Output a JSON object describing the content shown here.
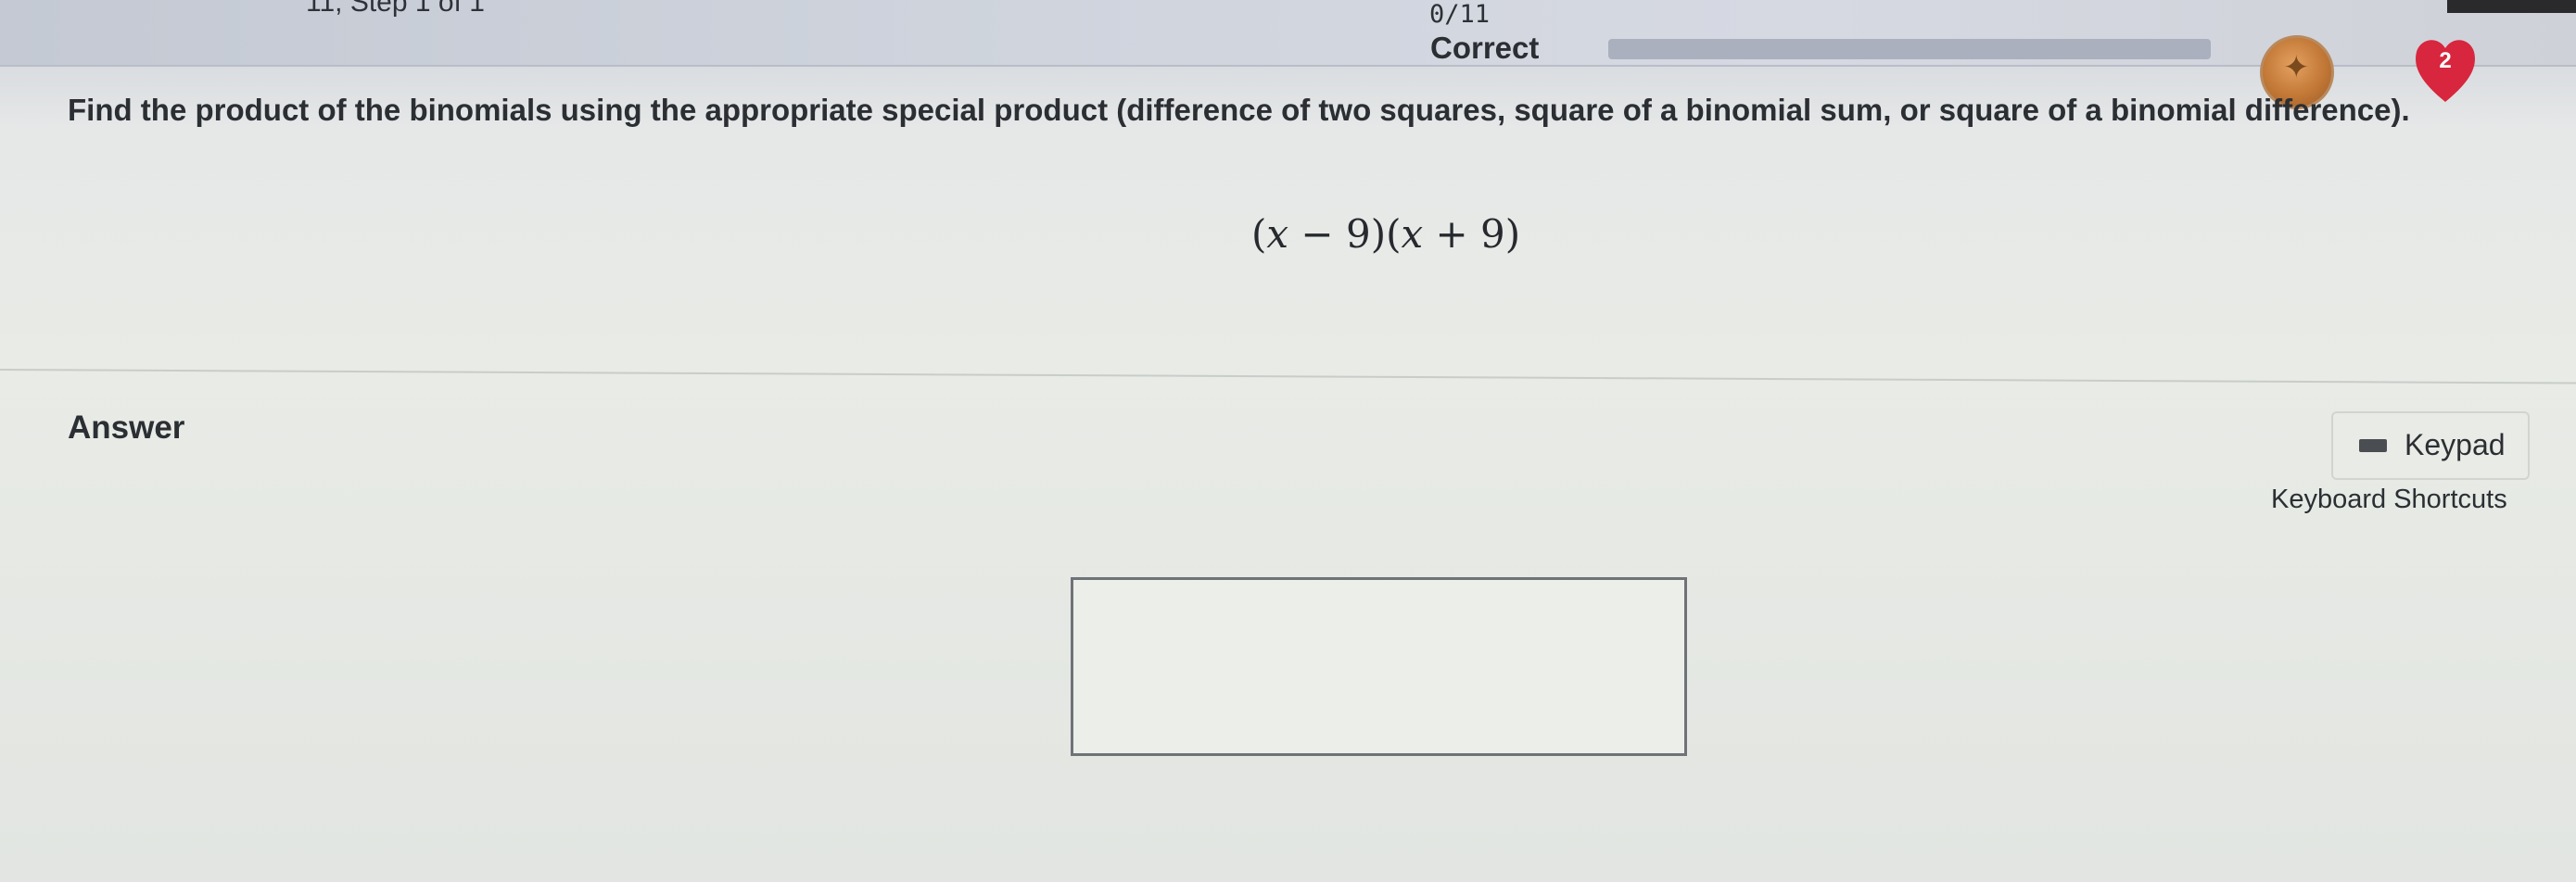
{
  "header": {
    "step_text": "11, Step 1 of 1",
    "progress_count": "0/11",
    "correct_label": "Correct",
    "progress_fraction": 0.0,
    "avatar_icon": "badge-icon",
    "hearts_count": "2",
    "heart_color": "#d7263d"
  },
  "question": {
    "prompt": "Find the product of the binomials using the appropriate special product (difference of two squares, square of a binomial sum, or square of a binomial difference).",
    "expression_parts": [
      "(",
      "x",
      " − 9)(",
      "x",
      " + 9)"
    ]
  },
  "answer": {
    "label": "Answer",
    "input_value": "",
    "keypad_label": "Keypad",
    "keypad_icon": "keyboard-icon",
    "shortcuts_label": "Keyboard Shortcuts"
  }
}
